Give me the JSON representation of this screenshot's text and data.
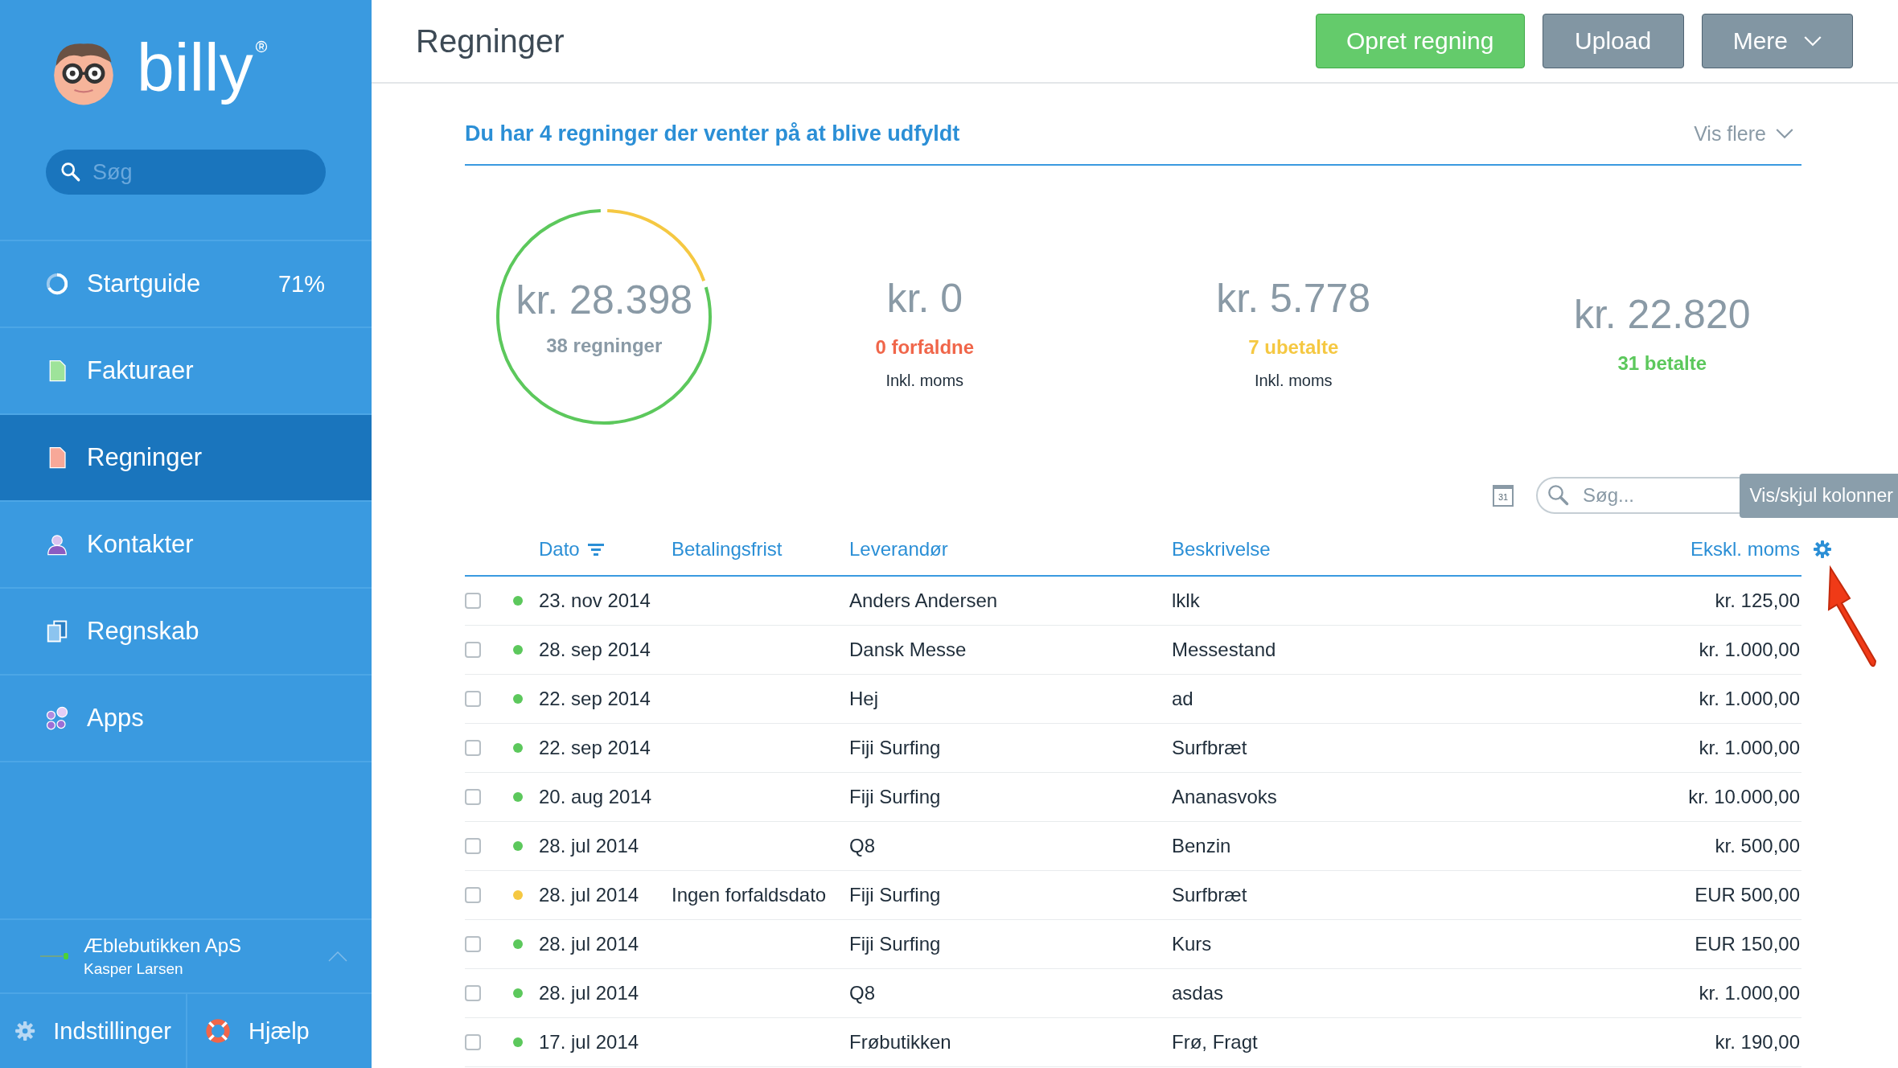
{
  "sidebar": {
    "logo": "billy",
    "search": {
      "placeholder": "Søg"
    },
    "items": [
      {
        "label": "Startguide",
        "badge": "71%",
        "selected": false
      },
      {
        "label": "Fakturaer",
        "selected": false
      },
      {
        "label": "Regninger",
        "selected": true
      },
      {
        "label": "Kontakter",
        "selected": false
      },
      {
        "label": "Regnskab",
        "selected": false
      },
      {
        "label": "Apps",
        "selected": false
      }
    ],
    "company": {
      "name": "Æblebutikken ApS",
      "user": "Kasper Larsen"
    },
    "footer": [
      {
        "label": "Indstillinger"
      },
      {
        "label": "Hjælp"
      }
    ]
  },
  "header": {
    "title": "Regninger",
    "buttons": [
      {
        "label": "Opret regning",
        "kind": "primary"
      },
      {
        "label": "Upload",
        "kind": "secondary"
      },
      {
        "label": "Mere",
        "kind": "menu"
      }
    ]
  },
  "banner": {
    "text": "Du har 4 regninger der venter på at blive udfyldt",
    "more": "Vis flere"
  },
  "summary": {
    "amount": "kr. 28.398",
    "count": "38 regninger"
  },
  "stats": [
    {
      "amount": "kr. 0",
      "label": "0 forfaldne",
      "note": "Inkl. moms",
      "color": "#f0664a"
    },
    {
      "amount": "kr. 5.778",
      "label": "7 ubetalte",
      "note": "Inkl. moms",
      "color": "#f5c842"
    },
    {
      "amount": "kr. 22.820",
      "label": "31 betalte",
      "color": "#5cc85c"
    }
  ],
  "toolbar": {
    "calendar": "31",
    "search": {
      "placeholder": "Søg..."
    },
    "tooltip": "Vis/skjul kolonner"
  },
  "table": {
    "columns": [
      {
        "label": "Dato",
        "sorted": true
      },
      {
        "label": "Betalingsfrist",
        "sorted": false
      },
      {
        "label": "Leverandør",
        "sorted": false
      },
      {
        "label": "Beskrivelse",
        "sorted": false
      },
      {
        "label": "Ekskl. moms",
        "sorted": false
      }
    ],
    "rows": [
      {
        "checked": false,
        "color": "#5cc85c",
        "date": "23. nov 2014",
        "supplier": "Anders Andersen",
        "description": "lklk",
        "amount": "kr. 125,00"
      },
      {
        "checked": false,
        "color": "#5cc85c",
        "date": "28. sep 2014",
        "supplier": "Dansk Messe",
        "description": "Messestand",
        "amount": "kr. 1.000,00"
      },
      {
        "checked": false,
        "color": "#5cc85c",
        "date": "22. sep 2014",
        "supplier": "Hej",
        "description": "ad",
        "amount": "kr. 1.000,00"
      },
      {
        "checked": false,
        "color": "#5cc85c",
        "date": "22. sep 2014",
        "supplier": "Fiji Surfing",
        "description": "Surfbræt",
        "amount": "kr. 1.000,00"
      },
      {
        "checked": false,
        "color": "#5cc85c",
        "date": "20. aug 2014",
        "supplier": "Fiji Surfing",
        "description": "Ananasvoks",
        "amount": "kr. 10.000,00"
      },
      {
        "checked": false,
        "color": "#5cc85c",
        "date": "28. jul 2014",
        "supplier": "Q8",
        "description": "Benzin",
        "amount": "kr. 500,00"
      },
      {
        "checked": false,
        "color": "#f5c842",
        "date": "28. jul 2014",
        "due": "Ingen forfaldsdato",
        "supplier": "Fiji Surfing",
        "description": "Surfbræt",
        "amount": "EUR 500,00"
      },
      {
        "checked": false,
        "color": "#5cc85c",
        "date": "28. jul 2014",
        "supplier": "Fiji Surfing",
        "description": "Kurs",
        "amount": "EUR 150,00"
      },
      {
        "checked": false,
        "color": "#5cc85c",
        "date": "28. jul 2014",
        "supplier": "Q8",
        "description": "asdas",
        "amount": "kr. 1.000,00"
      },
      {
        "checked": false,
        "color": "#5cc85c",
        "date": "17. jul 2014",
        "supplier": "Frøbutikken",
        "description": "Frø, Fragt",
        "amount": "kr. 190,00"
      }
    ]
  }
}
